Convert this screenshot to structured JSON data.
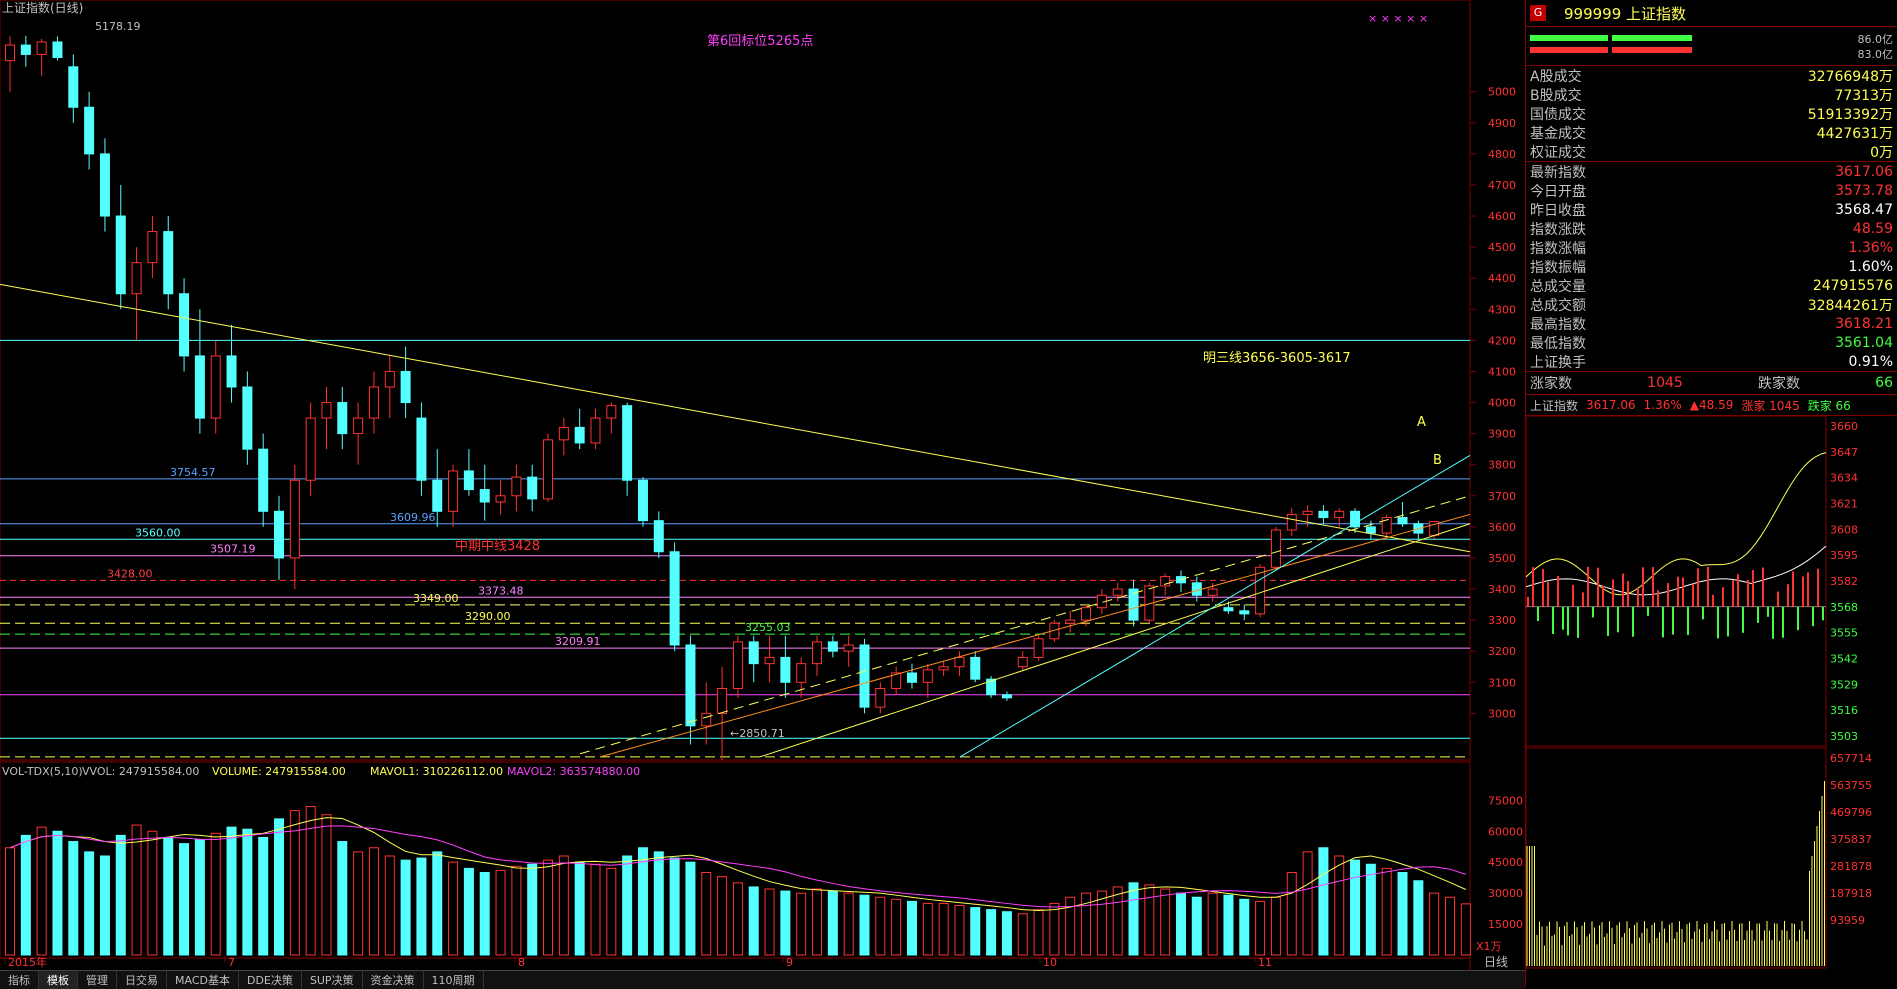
{
  "header": {
    "title": "上证指数(日线)",
    "peak_label": "5178.19",
    "annotation_top": "第6回标位5265点",
    "annotation_mid": "明三线3656-3605-3617",
    "mid_line_label": "中期中线3428",
    "point_a": "A",
    "point_b": "B",
    "low_label": "←2850.71",
    "x_marks": "× × × × ×"
  },
  "price_axis": [
    "5000",
    "4900",
    "4800",
    "4700",
    "4600",
    "4500",
    "4400",
    "4300",
    "4200",
    "4100",
    "4000",
    "3900",
    "3800",
    "3700",
    "3600",
    "3500",
    "3400",
    "3300",
    "3200",
    "3100",
    "3000"
  ],
  "level_labels": [
    {
      "text": "3754.57",
      "price": 3754.57,
      "color": "#5aa0ff"
    },
    {
      "text": "3609.96",
      "price": 3609.96,
      "color": "#5aa0ff"
    },
    {
      "text": "3560.00",
      "price": 3560.0,
      "color": "#5ff"
    },
    {
      "text": "3507.19",
      "price": 3507.19,
      "color": "#ff80ff"
    },
    {
      "text": "3428.00",
      "price": 3428.0,
      "color": "#ff4040"
    },
    {
      "text": "3373.48",
      "price": 3373.48,
      "color": "#ff80ff"
    },
    {
      "text": "3349.00",
      "price": 3349.0,
      "color": "#ffff54"
    },
    {
      "text": "3290.00",
      "price": 3290.0,
      "color": "#ffff54"
    },
    {
      "text": "3255.03",
      "price": 3255.03,
      "color": "#40ff40"
    },
    {
      "text": "3209.91",
      "price": 3209.91,
      "color": "#ff80ff"
    }
  ],
  "volume": {
    "header": "VOL-TDX(5,10)",
    "vvol": "VVOL: 247915584.00",
    "volume_value": "VOLUME: 247915584.00",
    "mavol1": "MAVOL1: 310226112.00",
    "mavol2": "MAVOL2: 363574880.00",
    "axis": [
      "75000",
      "60000",
      "45000",
      "30000",
      "15000"
    ],
    "unit": "X1万"
  },
  "date_axis": [
    "2015年",
    "7",
    "8",
    "9",
    "10",
    "11"
  ],
  "axis_mode": "日线",
  "tabs": [
    "指标",
    "模板",
    "管理",
    "日交易",
    "MACD基本",
    "DDE决策",
    "SUP决策",
    "资金决策",
    "110周期"
  ],
  "colors": {
    "up": "#ff3232",
    "down": "#54ffff",
    "ma_yellow": "#ffff54",
    "ma_magenta": "#ff40ff",
    "grid": "#800000"
  },
  "chart_data": {
    "type": "candlestick",
    "title": "上证指数(日线)",
    "y_unit": "index points",
    "ylim": [
      2850,
      5250
    ],
    "months": [
      "2015年",
      "7",
      "8",
      "9",
      "10",
      "11"
    ],
    "candles": [
      {
        "o": 5100,
        "h": 5178,
        "l": 5000,
        "c": 5150
      },
      {
        "o": 5150,
        "h": 5180,
        "l": 5080,
        "c": 5120
      },
      {
        "o": 5120,
        "h": 5170,
        "l": 5050,
        "c": 5160
      },
      {
        "o": 5160,
        "h": 5178,
        "l": 5100,
        "c": 5110
      },
      {
        "o": 5080,
        "h": 5120,
        "l": 4900,
        "c": 4950
      },
      {
        "o": 4950,
        "h": 5000,
        "l": 4750,
        "c": 4800
      },
      {
        "o": 4800,
        "h": 4850,
        "l": 4550,
        "c": 4600
      },
      {
        "o": 4600,
        "h": 4700,
        "l": 4300,
        "c": 4350
      },
      {
        "o": 4350,
        "h": 4500,
        "l": 4200,
        "c": 4450
      },
      {
        "o": 4450,
        "h": 4600,
        "l": 4400,
        "c": 4550
      },
      {
        "o": 4550,
        "h": 4600,
        "l": 4300,
        "c": 4350
      },
      {
        "o": 4350,
        "h": 4400,
        "l": 4100,
        "c": 4150
      },
      {
        "o": 4150,
        "h": 4300,
        "l": 3900,
        "c": 3950
      },
      {
        "o": 3950,
        "h": 4200,
        "l": 3900,
        "c": 4150
      },
      {
        "o": 4150,
        "h": 4250,
        "l": 4000,
        "c": 4050
      },
      {
        "o": 4050,
        "h": 4100,
        "l": 3800,
        "c": 3850
      },
      {
        "o": 3850,
        "h": 3900,
        "l": 3600,
        "c": 3650
      },
      {
        "o": 3650,
        "h": 3700,
        "l": 3430,
        "c": 3500
      },
      {
        "o": 3500,
        "h": 3800,
        "l": 3400,
        "c": 3750
      },
      {
        "o": 3750,
        "h": 4000,
        "l": 3700,
        "c": 3950
      },
      {
        "o": 3950,
        "h": 4050,
        "l": 3850,
        "c": 4000
      },
      {
        "o": 4000,
        "h": 4050,
        "l": 3850,
        "c": 3900
      },
      {
        "o": 3900,
        "h": 4000,
        "l": 3800,
        "c": 3950
      },
      {
        "o": 3950,
        "h": 4100,
        "l": 3900,
        "c": 4050
      },
      {
        "o": 4050,
        "h": 4150,
        "l": 3950,
        "c": 4100
      },
      {
        "o": 4100,
        "h": 4180,
        "l": 3950,
        "c": 4000
      },
      {
        "o": 3950,
        "h": 4000,
        "l": 3700,
        "c": 3750
      },
      {
        "o": 3750,
        "h": 3850,
        "l": 3600,
        "c": 3650
      },
      {
        "o": 3650,
        "h": 3800,
        "l": 3600,
        "c": 3780
      },
      {
        "o": 3780,
        "h": 3850,
        "l": 3700,
        "c": 3720
      },
      {
        "o": 3720,
        "h": 3800,
        "l": 3620,
        "c": 3680
      },
      {
        "o": 3680,
        "h": 3750,
        "l": 3640,
        "c": 3700
      },
      {
        "o": 3700,
        "h": 3800,
        "l": 3650,
        "c": 3760
      },
      {
        "o": 3760,
        "h": 3800,
        "l": 3650,
        "c": 3690
      },
      {
        "o": 3690,
        "h": 3900,
        "l": 3680,
        "c": 3880
      },
      {
        "o": 3880,
        "h": 3950,
        "l": 3830,
        "c": 3920
      },
      {
        "o": 3920,
        "h": 3980,
        "l": 3850,
        "c": 3870
      },
      {
        "o": 3870,
        "h": 3980,
        "l": 3850,
        "c": 3950
      },
      {
        "o": 3950,
        "h": 4000,
        "l": 3900,
        "c": 3990
      },
      {
        "o": 3990,
        "h": 4000,
        "l": 3700,
        "c": 3750
      },
      {
        "o": 3750,
        "h": 3760,
        "l": 3600,
        "c": 3620
      },
      {
        "o": 3620,
        "h": 3650,
        "l": 3500,
        "c": 3520
      },
      {
        "o": 3520,
        "h": 3550,
        "l": 3200,
        "c": 3220
      },
      {
        "o": 3220,
        "h": 3250,
        "l": 2900,
        "c": 2960
      },
      {
        "o": 2960,
        "h": 3100,
        "l": 2900,
        "c": 3000
      },
      {
        "o": 3000,
        "h": 3150,
        "l": 2850,
        "c": 3080
      },
      {
        "o": 3080,
        "h": 3250,
        "l": 3050,
        "c": 3230
      },
      {
        "o": 3230,
        "h": 3250,
        "l": 3100,
        "c": 3160
      },
      {
        "o": 3160,
        "h": 3250,
        "l": 3100,
        "c": 3180
      },
      {
        "o": 3180,
        "h": 3250,
        "l": 3050,
        "c": 3100
      },
      {
        "o": 3100,
        "h": 3180,
        "l": 3050,
        "c": 3160
      },
      {
        "o": 3160,
        "h": 3250,
        "l": 3120,
        "c": 3230
      },
      {
        "o": 3230,
        "h": 3250,
        "l": 3180,
        "c": 3200
      },
      {
        "o": 3200,
        "h": 3250,
        "l": 3150,
        "c": 3220
      },
      {
        "o": 3220,
        "h": 3240,
        "l": 3000,
        "c": 3020
      },
      {
        "o": 3020,
        "h": 3100,
        "l": 3000,
        "c": 3080
      },
      {
        "o": 3080,
        "h": 3150,
        "l": 3060,
        "c": 3130
      },
      {
        "o": 3130,
        "h": 3160,
        "l": 3080,
        "c": 3100
      },
      {
        "o": 3100,
        "h": 3160,
        "l": 3050,
        "c": 3140
      },
      {
        "o": 3140,
        "h": 3170,
        "l": 3120,
        "c": 3150
      },
      {
        "o": 3150,
        "h": 3200,
        "l": 3120,
        "c": 3180
      },
      {
        "o": 3180,
        "h": 3200,
        "l": 3100,
        "c": 3110
      },
      {
        "o": 3110,
        "h": 3120,
        "l": 3050,
        "c": 3060
      },
      {
        "o": 3060,
        "h": 3070,
        "l": 3040,
        "c": 3050
      },
      {
        "o": 3150,
        "h": 3200,
        "l": 3140,
        "c": 3180
      },
      {
        "o": 3180,
        "h": 3250,
        "l": 3170,
        "c": 3240
      },
      {
        "o": 3240,
        "h": 3300,
        "l": 3230,
        "c": 3290
      },
      {
        "o": 3290,
        "h": 3330,
        "l": 3260,
        "c": 3300
      },
      {
        "o": 3300,
        "h": 3350,
        "l": 3280,
        "c": 3340
      },
      {
        "o": 3340,
        "h": 3400,
        "l": 3320,
        "c": 3380
      },
      {
        "o": 3380,
        "h": 3420,
        "l": 3360,
        "c": 3400
      },
      {
        "o": 3400,
        "h": 3430,
        "l": 3280,
        "c": 3300
      },
      {
        "o": 3300,
        "h": 3420,
        "l": 3290,
        "c": 3410
      },
      {
        "o": 3410,
        "h": 3450,
        "l": 3380,
        "c": 3440
      },
      {
        "o": 3440,
        "h": 3460,
        "l": 3390,
        "c": 3420
      },
      {
        "o": 3420,
        "h": 3440,
        "l": 3360,
        "c": 3380
      },
      {
        "o": 3380,
        "h": 3420,
        "l": 3360,
        "c": 3400
      },
      {
        "o": 3340,
        "h": 3360,
        "l": 3320,
        "c": 3330
      },
      {
        "o": 3330,
        "h": 3350,
        "l": 3300,
        "c": 3320
      },
      {
        "o": 3320,
        "h": 3480,
        "l": 3310,
        "c": 3470
      },
      {
        "o": 3470,
        "h": 3600,
        "l": 3460,
        "c": 3590
      },
      {
        "o": 3590,
        "h": 3660,
        "l": 3570,
        "c": 3640
      },
      {
        "o": 3640,
        "h": 3670,
        "l": 3600,
        "c": 3650
      },
      {
        "o": 3650,
        "h": 3670,
        "l": 3610,
        "c": 3630
      },
      {
        "o": 3630,
        "h": 3660,
        "l": 3600,
        "c": 3650
      },
      {
        "o": 3650,
        "h": 3660,
        "l": 3580,
        "c": 3600
      },
      {
        "o": 3600,
        "h": 3620,
        "l": 3560,
        "c": 3580
      },
      {
        "o": 3580,
        "h": 3640,
        "l": 3560,
        "c": 3630
      },
      {
        "o": 3630,
        "h": 3680,
        "l": 3600,
        "c": 3610
      },
      {
        "o": 3610,
        "h": 3620,
        "l": 3560,
        "c": 3580
      },
      {
        "o": 3573,
        "h": 3618,
        "l": 3561,
        "c": 3617
      }
    ],
    "volumes": [
      52000,
      58000,
      62000,
      60000,
      55000,
      50000,
      48000,
      58000,
      63000,
      60000,
      57000,
      54000,
      56000,
      59000,
      62000,
      61000,
      57000,
      66000,
      70000,
      72000,
      68000,
      55000,
      50000,
      52000,
      48000,
      46000,
      47000,
      50000,
      45000,
      42000,
      40000,
      41000,
      43000,
      44000,
      46000,
      48000,
      45000,
      44000,
      42000,
      48000,
      52000,
      50000,
      47000,
      45000,
      40000,
      38000,
      35000,
      33000,
      32000,
      31000,
      30000,
      32000,
      31000,
      30000,
      29000,
      28000,
      27000,
      26000,
      25000,
      25000,
      24000,
      23000,
      22000,
      21000,
      20000,
      22000,
      25000,
      28000,
      30000,
      31000,
      33000,
      35000,
      34000,
      32000,
      30000,
      28000,
      30000,
      29000,
      27000,
      26000,
      28000,
      40000,
      50000,
      52000,
      48000,
      46000,
      44000,
      42000,
      40000,
      36000,
      30000,
      28000,
      24800
    ],
    "ma_lines": [
      {
        "name": "MAVOL1",
        "color": "#ffff54"
      },
      {
        "name": "MAVOL2",
        "color": "#ff40ff"
      }
    ]
  },
  "quote": {
    "badge": "G",
    "title": "999999 上证指数",
    "pct_high": "86.0亿",
    "pct_low": "83.0亿",
    "rows1": [
      {
        "label": "A股成交",
        "value": "32766948万",
        "color": "#ffff54"
      },
      {
        "label": "B股成交",
        "value": "77313万",
        "color": "#ffff54"
      },
      {
        "label": "国债成交",
        "value": "51913392万",
        "color": "#ffff54"
      },
      {
        "label": "基金成交",
        "value": "4427631万",
        "color": "#ffff54"
      },
      {
        "label": "权证成交",
        "value": "0万",
        "color": "#ffff54"
      }
    ],
    "rows2": [
      {
        "label": "最新指数",
        "value": "3617.06",
        "color": "#ff3232"
      },
      {
        "label": "今日开盘",
        "value": "3573.78",
        "color": "#ff3232"
      },
      {
        "label": "昨日收盘",
        "value": "3568.47",
        "color": "#ffffff"
      },
      {
        "label": "指数涨跌",
        "value": "48.59",
        "color": "#ff3232"
      },
      {
        "label": "指数涨幅",
        "value": "1.36%",
        "color": "#ff3232"
      },
      {
        "label": "指数振幅",
        "value": "1.60%",
        "color": "#ffffff"
      },
      {
        "label": "总成交量",
        "value": "247915576",
        "color": "#ffff54"
      },
      {
        "label": "总成交额",
        "value": "32844261万",
        "color": "#ffff54"
      },
      {
        "label": "最高指数",
        "value": "3618.21",
        "color": "#ff3232"
      },
      {
        "label": "最低指数",
        "value": "3561.04",
        "color": "#40ff40"
      },
      {
        "label": "上证换手",
        "value": "0.91%",
        "color": "#ffffff"
      }
    ],
    "breadth": {
      "up_label": "涨家数",
      "up": "1045",
      "down_label": "跌家数",
      "down": "66"
    },
    "intraday_header": "上证指数",
    "intraday_price": "3617.06",
    "intraday_pct": "1.36%",
    "intraday_chg": "▲48.59",
    "intraday_up": "涨家 1045",
    "intraday_down": "跌家 66",
    "intraday_axis": [
      "3660",
      "3647",
      "3634",
      "3621",
      "3608",
      "3595",
      "3582",
      "3568",
      "3555",
      "3542",
      "3529",
      "3516",
      "3503"
    ],
    "intraday_vol_axis": [
      "657714",
      "563755",
      "469796",
      "375837",
      "281878",
      "187918",
      "93959"
    ]
  }
}
